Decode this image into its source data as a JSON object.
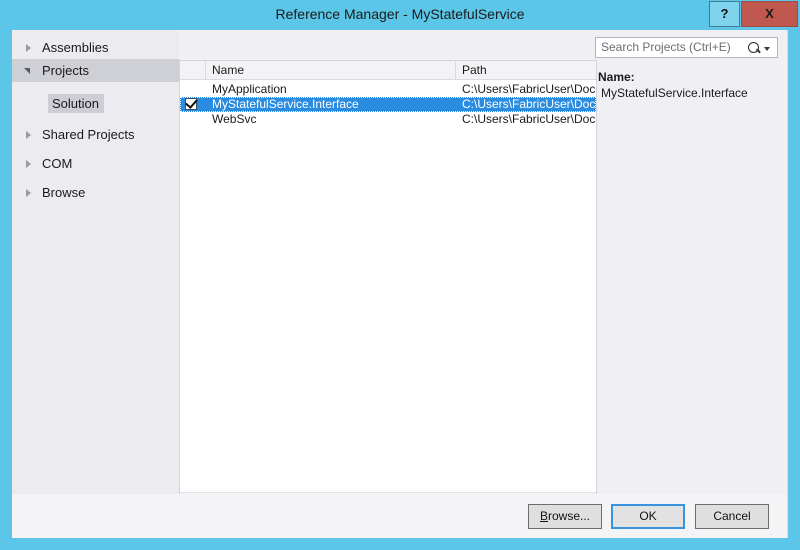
{
  "window": {
    "title": "Reference Manager - MyStatefulService",
    "help_label": "?",
    "close_label": "X"
  },
  "sidebar": {
    "items": [
      {
        "label": "Assemblies",
        "state": "collapsed"
      },
      {
        "label": "Projects",
        "state": "expanded"
      },
      {
        "label": "Shared Projects",
        "state": "collapsed"
      },
      {
        "label": "COM",
        "state": "collapsed"
      },
      {
        "label": "Browse",
        "state": "collapsed"
      }
    ],
    "sub_item": {
      "label": "Solution"
    }
  },
  "search": {
    "placeholder": "Search Projects (Ctrl+E)",
    "value": "",
    "icon": "search-icon"
  },
  "list": {
    "columns": [
      {
        "key": "check",
        "label": ""
      },
      {
        "key": "name",
        "label": "Name"
      },
      {
        "key": "path",
        "label": "Path"
      }
    ],
    "rows": [
      {
        "checked": false,
        "selected": false,
        "name": "MyApplication",
        "path": "C:\\Users\\FabricUser\\Docu"
      },
      {
        "checked": true,
        "selected": true,
        "name": "MyStatefulService.Interface",
        "path": "C:\\Users\\FabricUser\\Docu"
      },
      {
        "checked": false,
        "selected": false,
        "name": "WebSvc",
        "path": "C:\\Users\\FabricUser\\Docu"
      }
    ]
  },
  "details": {
    "name_label": "Name:",
    "name_value": "MyStatefulService.Interface"
  },
  "footer": {
    "browse_label": "Browse...",
    "browse_accel": "B",
    "ok_label": "OK",
    "cancel_label": "Cancel"
  },
  "colors": {
    "titlebar": "#5bc6e8",
    "selection": "#2a8ce0",
    "close_button": "#c1584f",
    "focus_border": "#3a93dd"
  }
}
